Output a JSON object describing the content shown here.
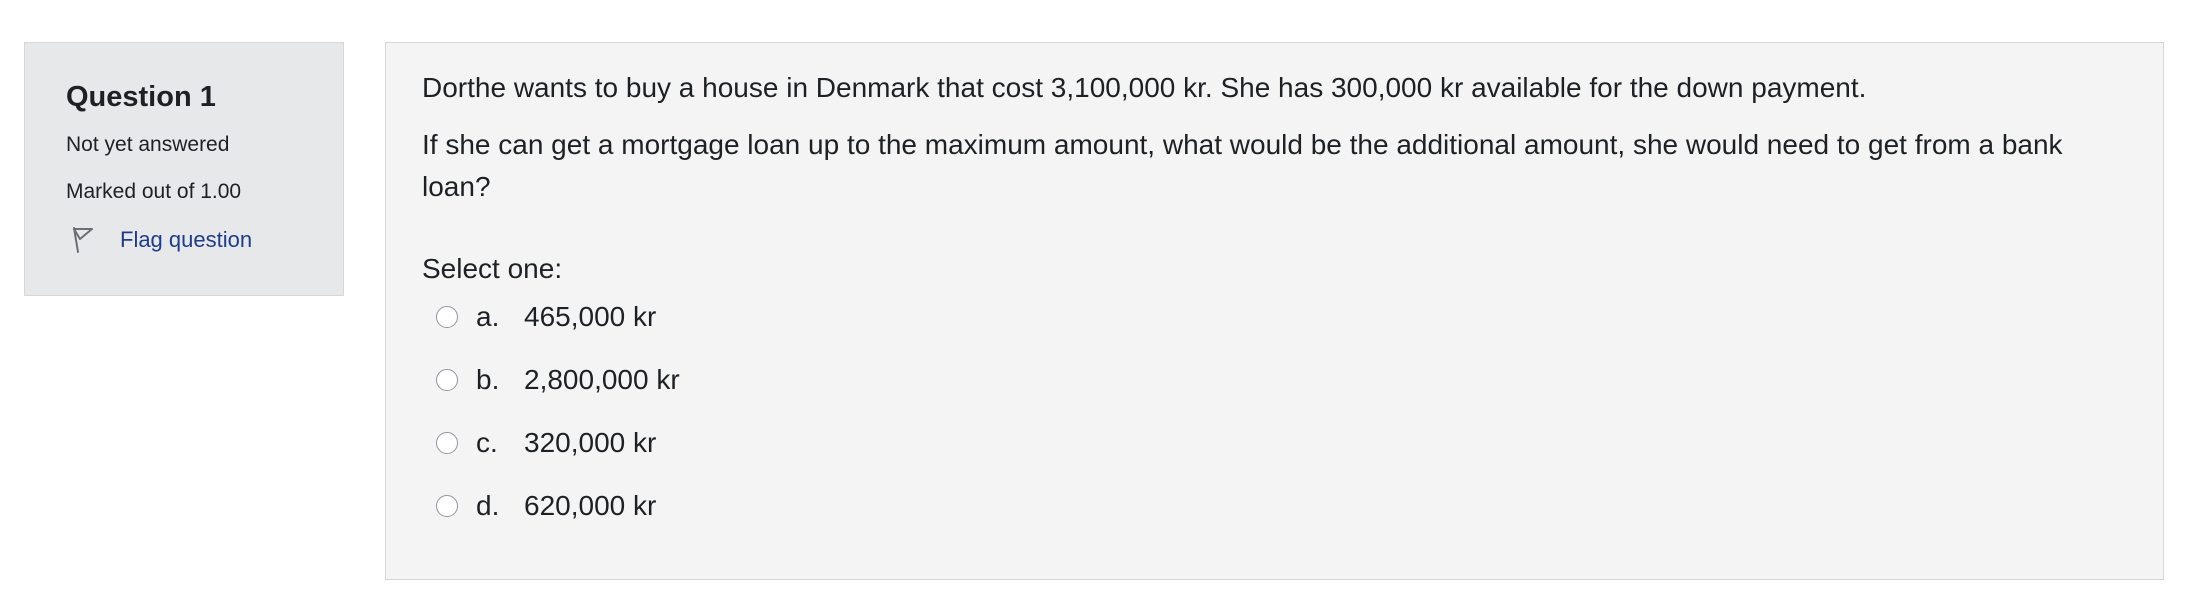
{
  "info": {
    "title": "Question 1",
    "status": "Not yet answered",
    "marks": "Marked out of 1.00",
    "flag_label": "Flag question"
  },
  "question": {
    "paragraphs": [
      "Dorthe wants to buy a house in Denmark that cost 3,100,000 kr. She has 300,000 kr available for the down payment.",
      "If she can get a mortgage loan up to the maximum amount, what would be the additional amount, she would need to get from a bank loan?"
    ],
    "prompt": "Select one:",
    "options": [
      {
        "letter": "a.",
        "text": "465,000 kr"
      },
      {
        "letter": "b.",
        "text": "2,800,000 kr"
      },
      {
        "letter": "c.",
        "text": "320,000 kr"
      },
      {
        "letter": "d.",
        "text": "620,000 kr"
      }
    ]
  },
  "colors": {
    "link": "#1f3c8a",
    "info_bg": "#e7e8ea",
    "content_bg": "#f4f4f4"
  }
}
